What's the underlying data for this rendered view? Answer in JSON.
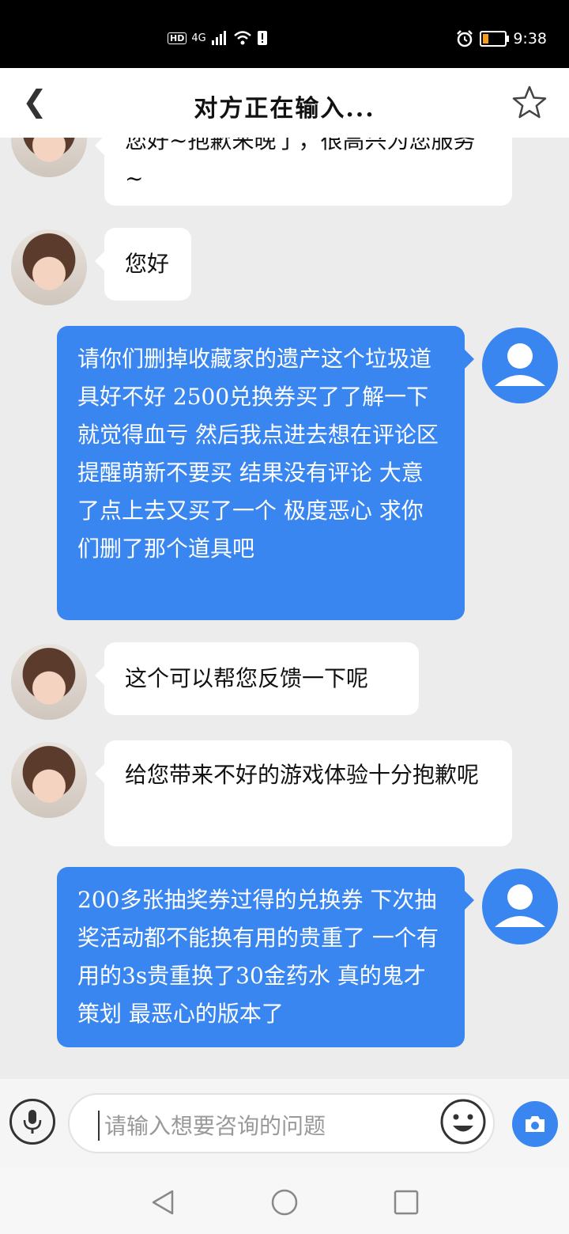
{
  "status_bar": {
    "hd": "HD",
    "network": "4G",
    "time": "9:38",
    "battery_level": 0.25,
    "battery_color": "#f79b1e"
  },
  "header": {
    "title": "对方正在输入..."
  },
  "messages": [
    {
      "from": "agent",
      "text": "您好~抱歉来晚了，很高兴为您服务~"
    },
    {
      "from": "agent",
      "text": "您好"
    },
    {
      "from": "user",
      "text": "请你们删掉收藏家的遗产这个垃圾道具好不好 2500兑换券买了了解一下就觉得血亏 然后我点进去想在评论区提醒萌新不要买 结果没有评论 大意了点上去又买了一个 极度恶心 求你们删了那个道具吧"
    },
    {
      "from": "agent",
      "text": "这个可以帮您反馈一下呢"
    },
    {
      "from": "agent",
      "text": "给您带来不好的游戏体验十分抱歉呢"
    },
    {
      "from": "user",
      "text": "200多张抽奖券过得的兑换券 下次抽奖活动都不能换有用的贵重了 一个有用的3s贵重换了30金药水 真的鬼才策划 最恶心的版本了"
    }
  ],
  "input": {
    "placeholder": "请输入想要咨询的问题"
  },
  "colors": {
    "accent": "#3a86f0",
    "background": "#ececec"
  }
}
